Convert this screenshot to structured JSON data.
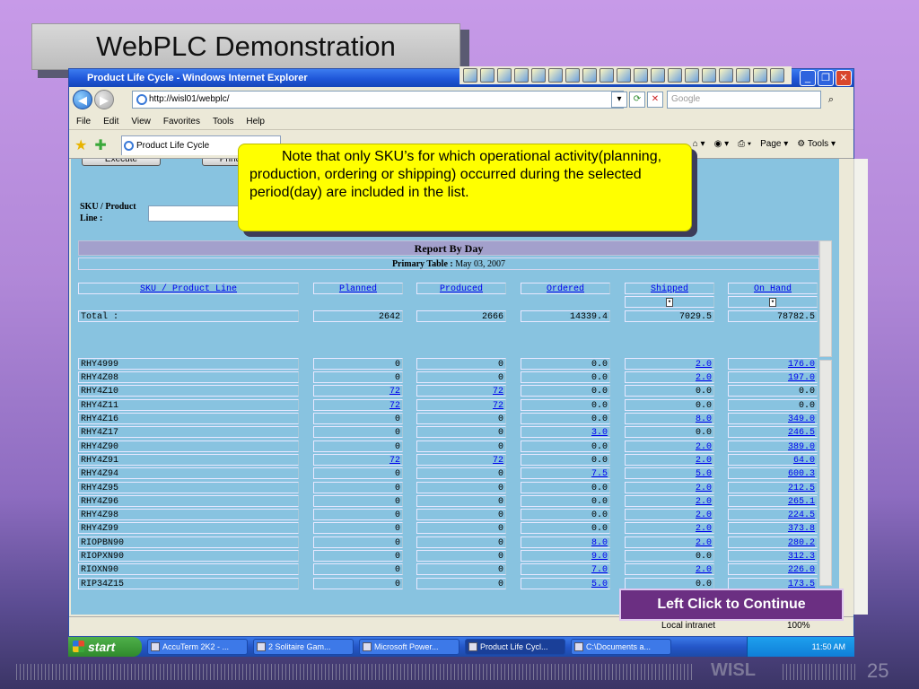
{
  "slide": {
    "title": "WebPLC Demonstration",
    "callout": "Note that only SKU’s for which operational activity(planning, production, ordering or shipping) occurred during the selected period(day) are included in the list.",
    "continue_label": "Left Click to Continue",
    "footer_brand": "WISL",
    "page_number": "25"
  },
  "browser": {
    "window_title": "Product Life Cycle - Windows Internet Explorer",
    "address": "http://wisl01/webplc/",
    "search_placeholder": "Google",
    "menu": [
      "File",
      "Edit",
      "View",
      "Favorites",
      "Tools",
      "Help"
    ],
    "tab_title": "Product Life Cycle",
    "page_menu": "Page",
    "tools_menu": "Tools",
    "status_zone": "Local intranet",
    "zoom": "100%"
  },
  "form": {
    "execute_label": "Execute",
    "print_label": "Print",
    "sku_label": "SKU / Product Line :"
  },
  "report": {
    "title": "Report By Day",
    "primary_label": "Primary Table :",
    "primary_date": "May 03, 2007",
    "columns": [
      "SKU / Product Line",
      "Planned",
      "Produced",
      "Ordered",
      "Shipped",
      "On Hand"
    ],
    "total": {
      "label": "Total :",
      "planned": "2642",
      "produced": "2666",
      "ordered": "14339.4",
      "shipped": "7029.5",
      "on_hand": "78782.5"
    },
    "rows": [
      {
        "sku": "RHY4999",
        "planned": "0",
        "produced": "0",
        "ordered": "0.0",
        "shipped": "2.0",
        "on_hand": "176.0"
      },
      {
        "sku": "RHY4Z08",
        "planned": "0",
        "produced": "0",
        "ordered": "0.0",
        "shipped": "2.0",
        "on_hand": "197.0"
      },
      {
        "sku": "RHY4Z10",
        "planned": "72",
        "produced": "72",
        "ordered": "0.0",
        "shipped": "0.0",
        "on_hand": "0.0"
      },
      {
        "sku": "RHY4Z11",
        "planned": "72",
        "produced": "72",
        "ordered": "0.0",
        "shipped": "0.0",
        "on_hand": "0.0"
      },
      {
        "sku": "RHY4Z16",
        "planned": "0",
        "produced": "0",
        "ordered": "0.0",
        "shipped": "8.0",
        "on_hand": "349.0"
      },
      {
        "sku": "RHY4Z17",
        "planned": "0",
        "produced": "0",
        "ordered": "3.0",
        "shipped": "0.0",
        "on_hand": "246.5"
      },
      {
        "sku": "RHY4Z90",
        "planned": "0",
        "produced": "0",
        "ordered": "0.0",
        "shipped": "2.0",
        "on_hand": "389.0"
      },
      {
        "sku": "RHY4Z91",
        "planned": "72",
        "produced": "72",
        "ordered": "0.0",
        "shipped": "2.0",
        "on_hand": "64.0"
      },
      {
        "sku": "RHY4Z94",
        "planned": "0",
        "produced": "0",
        "ordered": "7.5",
        "shipped": "5.0",
        "on_hand": "600.3"
      },
      {
        "sku": "RHY4Z95",
        "planned": "0",
        "produced": "0",
        "ordered": "0.0",
        "shipped": "2.0",
        "on_hand": "212.5"
      },
      {
        "sku": "RHY4Z96",
        "planned": "0",
        "produced": "0",
        "ordered": "0.0",
        "shipped": "2.0",
        "on_hand": "265.1"
      },
      {
        "sku": "RHY4Z98",
        "planned": "0",
        "produced": "0",
        "ordered": "0.0",
        "shipped": "2.0",
        "on_hand": "224.5"
      },
      {
        "sku": "RHY4Z99",
        "planned": "0",
        "produced": "0",
        "ordered": "0.0",
        "shipped": "2.0",
        "on_hand": "373.8"
      },
      {
        "sku": "RIOPBN90",
        "planned": "0",
        "produced": "0",
        "ordered": "8.0",
        "shipped": "2.0",
        "on_hand": "280.2"
      },
      {
        "sku": "RIOPXN90",
        "planned": "0",
        "produced": "0",
        "ordered": "9.0",
        "shipped": "0.0",
        "on_hand": "312.3"
      },
      {
        "sku": "RIOXN90",
        "planned": "0",
        "produced": "0",
        "ordered": "7.0",
        "shipped": "2.0",
        "on_hand": "226.0"
      },
      {
        "sku": "RIP34Z15",
        "planned": "0",
        "produced": "0",
        "ordered": "5.0",
        "shipped": "0.0",
        "on_hand": "173.5"
      }
    ]
  },
  "taskbar": {
    "start_label": "start",
    "tasks": [
      "AccuTerm 2K2 - ...",
      "2 Solitaire Gam...",
      "Microsoft Power...",
      "Product Life Cycl...",
      "C:\\Documents a..."
    ],
    "clock": "11:50 AM"
  }
}
